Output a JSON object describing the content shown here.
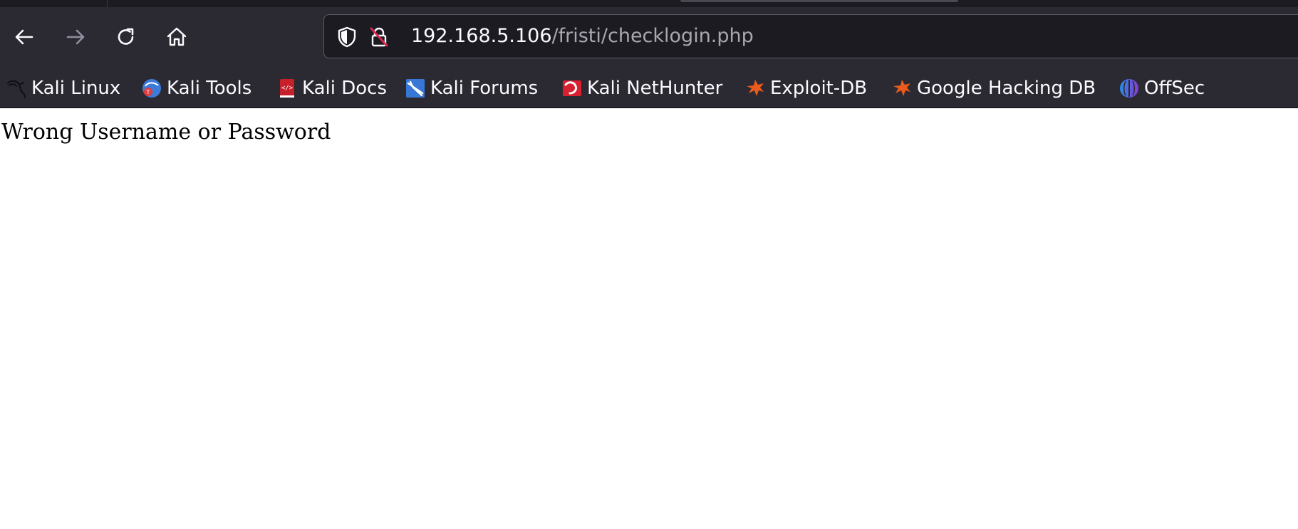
{
  "browser": {
    "nav": {
      "back_icon": "back-arrow-icon",
      "forward_icon": "forward-arrow-icon",
      "reload_icon": "reload-icon",
      "home_icon": "home-icon"
    },
    "urlbar": {
      "host": "192.168.5.106",
      "path": "/fristi/checklogin.php",
      "tracking_icon": "shield-icon",
      "security_icon": "insecure-lock-icon"
    },
    "bookmarks": [
      {
        "label": "Kali Linux",
        "icon": "kali-dragon-icon"
      },
      {
        "label": "Kali Tools",
        "icon": "kali-tools-icon"
      },
      {
        "label": "Kali Docs",
        "icon": "kali-docs-icon"
      },
      {
        "label": "Kali Forums",
        "icon": "kali-forums-icon"
      },
      {
        "label": "Kali NetHunter",
        "icon": "kali-nethunter-icon"
      },
      {
        "label": "Exploit-DB",
        "icon": "exploit-db-icon"
      },
      {
        "label": "Google Hacking DB",
        "icon": "exploit-db-icon"
      },
      {
        "label": "OffSec",
        "icon": "offsec-icon"
      }
    ]
  },
  "page": {
    "message": "Wrong Username or Password"
  },
  "colors": {
    "toolbar": "#2b2a33",
    "urlbar": "#1c1b22",
    "text": "#fbfbfe",
    "muted": "#a8a8b0"
  }
}
